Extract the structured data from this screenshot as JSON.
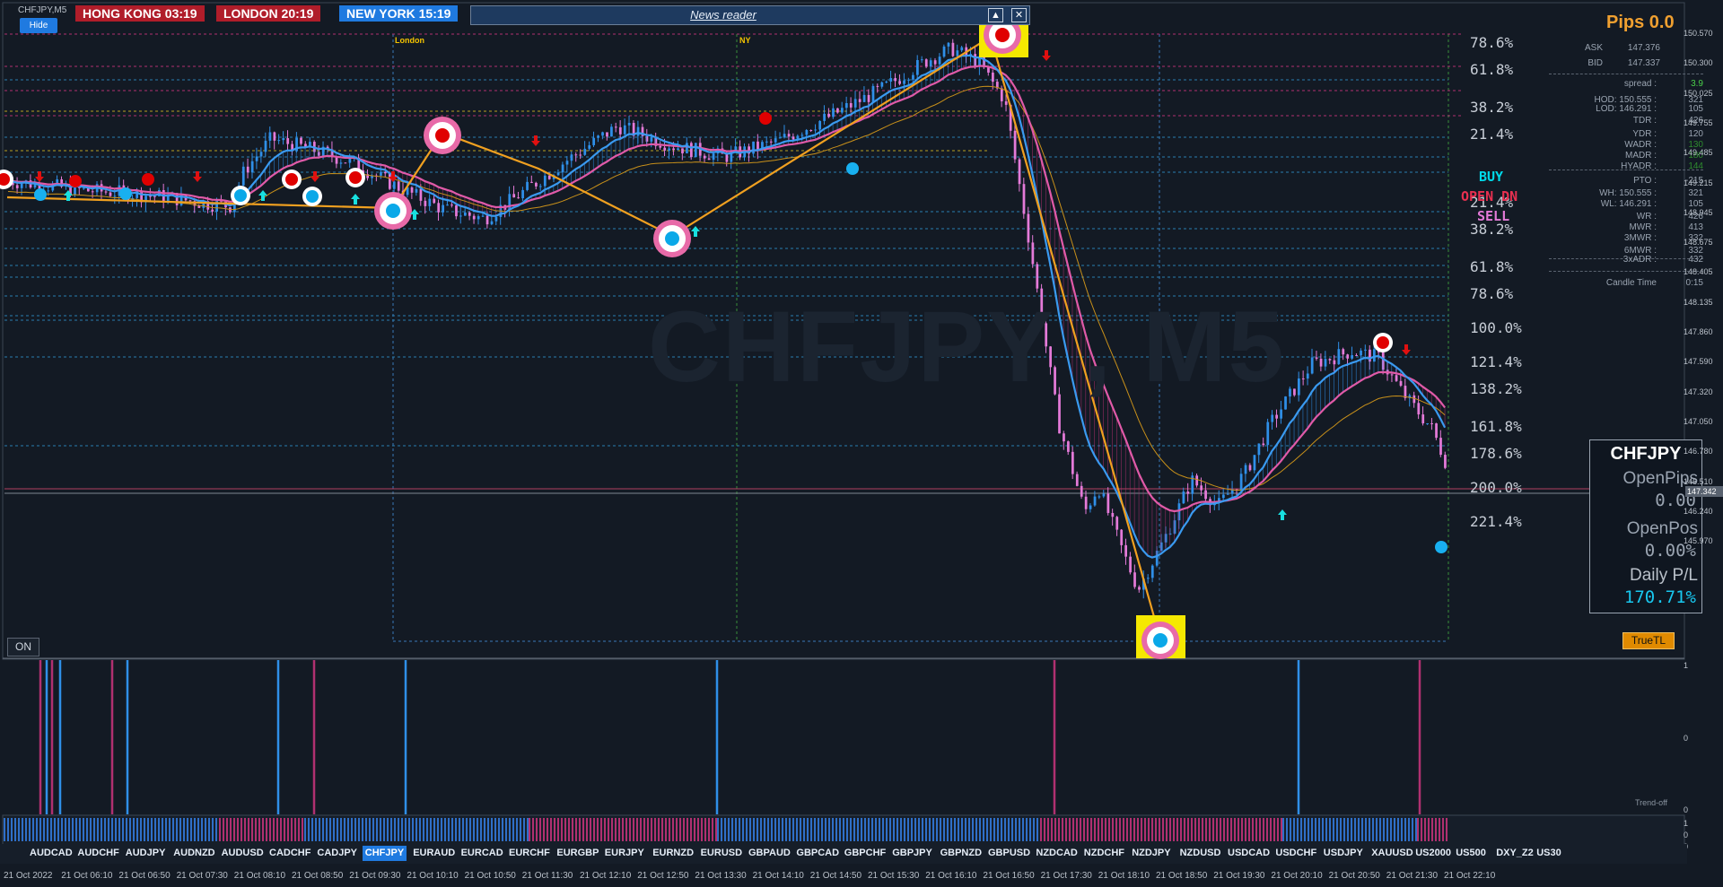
{
  "window": {
    "title": "CHFJPY,M5"
  },
  "sessions": [
    {
      "label": "HONG KONG  03:19",
      "color": "#b01d2a"
    },
    {
      "label": "LONDON  20:19",
      "color": "#b01d2a"
    },
    {
      "label": "NEW YORK  15:19",
      "color": "#1f7ae0"
    }
  ],
  "hide_label": "Hide",
  "news": {
    "title": "News reader",
    "collapse_icon": "caret-up-icon",
    "close_icon": "close-icon"
  },
  "watermark": "CHFJPY , M5",
  "session_tags": {
    "london": "London",
    "ny": "NY"
  },
  "fib_levels": [
    "78.6%",
    "61.8%",
    "38.2%",
    "21.4%",
    "21.4%",
    "38.2%",
    "61.8%",
    "78.6%",
    "100.0%",
    "121.4%",
    "138.2%",
    "161.8%",
    "178.6%",
    "200.0%",
    "221.4%"
  ],
  "signals": {
    "buy": "BUY",
    "open": "OPEN DN",
    "sell": "SELL"
  },
  "info": {
    "pips": "Pips 0.0",
    "ask_label": "ASK",
    "ask": "147.376",
    "bid_label": "BID",
    "bid": "147.337",
    "rows": [
      {
        "k": "spread :",
        "v": "3.9",
        "c": "#4ad04a"
      },
      {
        "k": "HOD: 150.555 :",
        "v": "321",
        "c": "#9aa4b1"
      },
      {
        "k": "LOD: 146.291 :",
        "v": "105",
        "c": "#9aa4b1"
      },
      {
        "k": "TDR :",
        "v": "426",
        "c": "#9aa4b1"
      },
      {
        "k": "YDR :",
        "v": "120",
        "c": "#9aa4b1"
      },
      {
        "k": "WADR :",
        "v": "130",
        "c": "#2e8b2e"
      },
      {
        "k": "MADR :",
        "v": "180",
        "c": "#2e8b2e"
      },
      {
        "k": "HYADR :",
        "v": "144",
        "c": "#2e8b2e"
      },
      {
        "k": "PTO :",
        "v": "-215",
        "c": "#9aa4b1"
      },
      {
        "k": "WH: 150.555 :",
        "v": "321",
        "c": "#9aa4b1"
      },
      {
        "k": "WL: 146.291 :",
        "v": "105",
        "c": "#9aa4b1"
      },
      {
        "k": "WR :",
        "v": "426",
        "c": "#9aa4b1"
      },
      {
        "k": "MWR :",
        "v": "413",
        "c": "#9aa4b1"
      },
      {
        "k": "3MWR :",
        "v": "332",
        "c": "#9aa4b1"
      },
      {
        "k": "6MWR :",
        "v": "332",
        "c": "#9aa4b1"
      },
      {
        "k": "3xADR :",
        "v": "432",
        "c": "#9aa4b1"
      },
      {
        "k": "Candle Time",
        "v": "0:15",
        "c": "#9aa4b1"
      }
    ]
  },
  "panel": {
    "symbol": "CHFJPY",
    "open_pips_label": "OpenPips",
    "open_pips": "0.00",
    "open_pos_label": "OpenPos",
    "open_pos": "0.00%",
    "daily_label": "Daily P/L",
    "daily": "170.71%"
  },
  "truetl_label": "TrueTL",
  "on_label": "ON",
  "trend_off_label": "Trend-off",
  "price_axis": [
    "150.570",
    "150.300",
    "150.025",
    "149.755",
    "149.485",
    "149.215",
    "148.945",
    "148.675",
    "148.405",
    "148.135",
    "147.860",
    "147.590",
    "147.320",
    "147.050",
    "146.780",
    "146.510",
    "146.240",
    "145.970"
  ],
  "current_price": "147.342",
  "sub_axis": [
    "1",
    "0",
    "0",
    "1",
    "0",
    "0"
  ],
  "symbols": [
    "AUDCAD",
    "AUDCHF",
    "AUDJPY",
    "AUDNZD",
    "AUDUSD",
    "CADCHF",
    "CADJPY",
    "CHFJPY",
    "EURAUD",
    "EURCAD",
    "EURCHF",
    "EURGBP",
    "EURJPY",
    "EURNZD",
    "EURUSD",
    "GBPAUD",
    "GBPCAD",
    "GBPCHF",
    "GBPJPY",
    "GBPNZD",
    "GBPUSD",
    "NZDCAD",
    "NZDCHF",
    "NZDJPY",
    "NZDUSD",
    "USDCAD",
    "USDCHF",
    "USDJPY",
    "XAUUSD",
    "US2000",
    "US500",
    "DXY_Z2",
    "US30"
  ],
  "active_symbol": "CHFJPY",
  "time_labels": [
    "21 Oct 2022",
    "21 Oct 06:10",
    "21 Oct 06:50",
    "21 Oct 07:30",
    "21 Oct 08:10",
    "21 Oct 08:50",
    "21 Oct 09:30",
    "21 Oct 10:10",
    "21 Oct 10:50",
    "21 Oct 11:30",
    "21 Oct 12:10",
    "21 Oct 12:50",
    "21 Oct 13:30",
    "21 Oct 14:10",
    "21 Oct 14:50",
    "21 Oct 15:30",
    "21 Oct 16:10",
    "21 Oct 16:50",
    "21 Oct 17:30",
    "21 Oct 18:10",
    "21 Oct 18:50",
    "21 Oct 19:30",
    "21 Oct 20:10",
    "21 Oct 20:50",
    "21 Oct 21:30",
    "21 Oct 22:10"
  ],
  "colors": {
    "bull": "#2f8fe8",
    "bear": "#e47ad8",
    "ma_pink": "#e05aa8",
    "ma_blue": "#3a9af0",
    "zigzag": "#f0a020",
    "accent": "#1f7ae0"
  },
  "chart_data": {
    "type": "candlestick",
    "symbol": "CHFJPY",
    "timeframe": "M5",
    "price_range": [
      146.0,
      150.6
    ],
    "path": [
      [
        0,
        149.48
      ],
      [
        6,
        149.44
      ],
      [
        12,
        149.4
      ],
      [
        18,
        149.38
      ],
      [
        24,
        149.35
      ],
      [
        30,
        149.3
      ],
      [
        34,
        149.28
      ],
      [
        36,
        149.55
      ],
      [
        40,
        149.8
      ],
      [
        46,
        149.72
      ],
      [
        52,
        149.62
      ],
      [
        60,
        149.4
      ],
      [
        66,
        149.25
      ],
      [
        72,
        149.18
      ],
      [
        76,
        149.32
      ],
      [
        84,
        149.62
      ],
      [
        92,
        149.9
      ],
      [
        100,
        149.75
      ],
      [
        108,
        149.66
      ],
      [
        116,
        149.78
      ],
      [
        124,
        149.98
      ],
      [
        132,
        150.2
      ],
      [
        138,
        150.4
      ],
      [
        142,
        150.5
      ],
      [
        146,
        150.4
      ],
      [
        150,
        150.1
      ],
      [
        154,
        148.9
      ],
      [
        158,
        147.6
      ],
      [
        162,
        146.9
      ],
      [
        164,
        147.1
      ],
      [
        168,
        146.55
      ],
      [
        170,
        146.3
      ],
      [
        174,
        146.7
      ],
      [
        178,
        147.15
      ],
      [
        182,
        146.95
      ],
      [
        186,
        147.2
      ],
      [
        190,
        147.6
      ],
      [
        196,
        148.05
      ],
      [
        202,
        148.15
      ],
      [
        206,
        148.1
      ],
      [
        210,
        147.8
      ],
      [
        214,
        147.55
      ],
      [
        216,
        147.3
      ]
    ]
  }
}
